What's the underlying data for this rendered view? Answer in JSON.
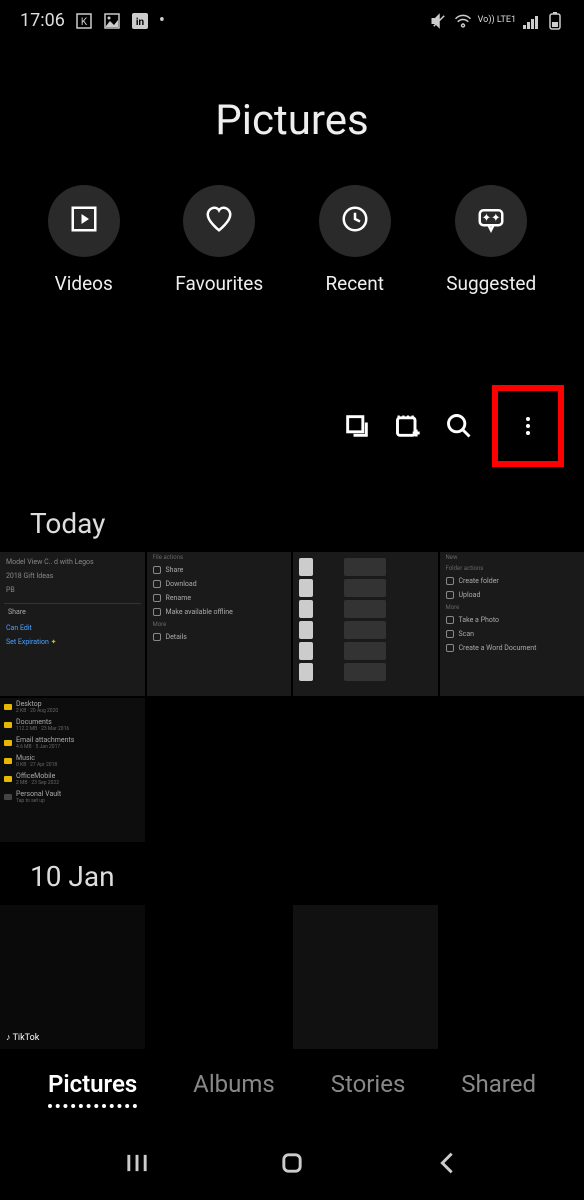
{
  "status": {
    "time": "17:06",
    "network_label": "Vo)) LTE1"
  },
  "page_title": "Pictures",
  "categories": [
    {
      "label": "Videos",
      "icon": "play-box"
    },
    {
      "label": "Favourites",
      "icon": "heart"
    },
    {
      "label": "Recent",
      "icon": "clock"
    },
    {
      "label": "Suggested",
      "icon": "chat-sparkle"
    }
  ],
  "sections": [
    {
      "title": "Today"
    },
    {
      "title": "10 Jan"
    }
  ],
  "thumb_menus": {
    "share_panel": {
      "items": [
        "Model View C.. d with Legos",
        "2018 Gift Ideas",
        "PB"
      ],
      "share": "Share",
      "can_edit": "Can Edit",
      "set_expiration": "Set Expiration"
    },
    "file_actions": {
      "header": "File actions",
      "items": [
        "Share",
        "Download",
        "Rename",
        "Make available offline"
      ],
      "more_header": "More",
      "more_items": [
        "Details"
      ]
    },
    "folder_actions": {
      "new_header": "New",
      "folder_header": "Folder actions",
      "folder_items": [
        "Create folder",
        "Upload"
      ],
      "more_header": "More",
      "more_items": [
        "Take a Photo",
        "Scan",
        "Create a Word Document"
      ]
    },
    "folder_list": [
      {
        "name": "Desktop",
        "meta": "2 KB · 20 Aug 2020"
      },
      {
        "name": "Documents",
        "meta": "112.2 MB · 23 Mar 2016"
      },
      {
        "name": "Email attachments",
        "meta": "4.6 MB · 5 Jan 2017"
      },
      {
        "name": "Music",
        "meta": "0 KB · 27 Apr 2018"
      },
      {
        "name": "OfficeMobile",
        "meta": "2 MB · 23 Sep 2022"
      },
      {
        "name": "Personal Vault",
        "meta": "Tap to set up"
      }
    ]
  },
  "tabs": [
    {
      "label": "Pictures",
      "active": true
    },
    {
      "label": "Albums",
      "active": false
    },
    {
      "label": "Stories",
      "active": false
    },
    {
      "label": "Shared",
      "active": false
    }
  ],
  "tiktok_label": "TikTok"
}
